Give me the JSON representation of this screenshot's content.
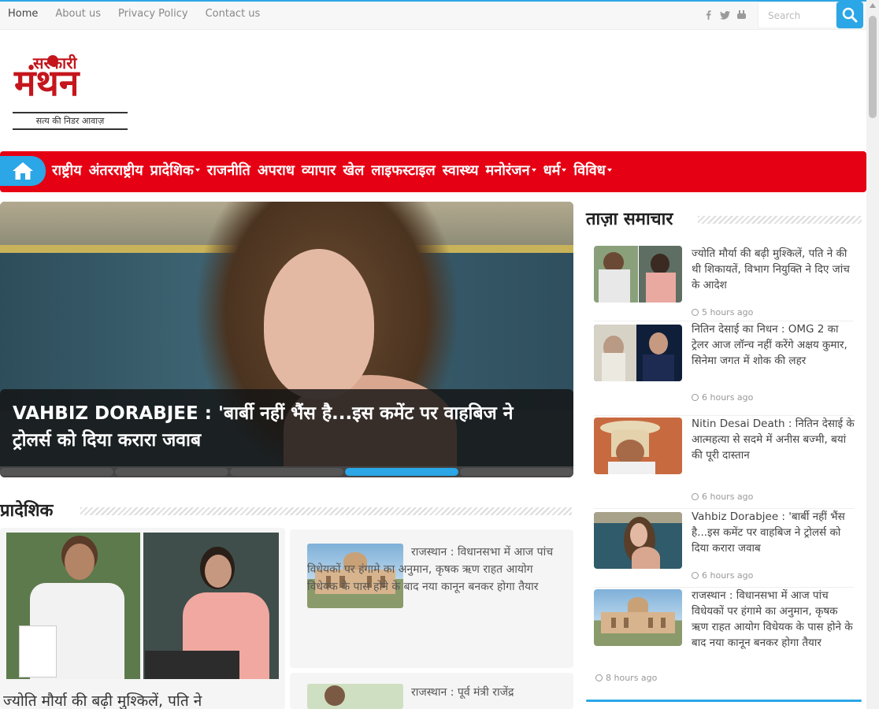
{
  "topbar": {
    "nav": [
      "Home",
      "About us",
      "Privacy Policy",
      "Contact us"
    ],
    "search_placeholder": "Search"
  },
  "logo": {
    "top": "सरकारी",
    "main": "मंथन",
    "tagline": "सत्य की निडर आवाज़"
  },
  "mainnav": {
    "items": [
      {
        "label": "राष्ट्रीय",
        "dropdown": false
      },
      {
        "label": "अंतरराष्ट्रीय",
        "dropdown": false
      },
      {
        "label": "प्रादेशिक",
        "dropdown": true
      },
      {
        "label": "राजनीति",
        "dropdown": false
      },
      {
        "label": "अपराध",
        "dropdown": false
      },
      {
        "label": "व्यापार",
        "dropdown": false
      },
      {
        "label": "खेल",
        "dropdown": false
      },
      {
        "label": "लाइफस्टाइल",
        "dropdown": false
      },
      {
        "label": "स्वास्थ्य",
        "dropdown": false
      },
      {
        "label": "मनोरंजन",
        "dropdown": true
      },
      {
        "label": "धर्म",
        "dropdown": true
      },
      {
        "label": "विविध",
        "dropdown": true
      }
    ]
  },
  "slider": {
    "caption": "VAHBIZ DORABJEE : 'बार्बी नहीं भैंस है...इस कमेंट पर वाहबिज ने ट्रोलर्स को दिया करारा जवाब",
    "active_slide": 4,
    "slide_count": 5
  },
  "latest": {
    "heading": "ताज़ा समाचार",
    "items": [
      {
        "title": "ज्योति मौर्या की बढ़ी मुश्किलें, पति ने की थी शिकायतें, विभाग नियुक्ति ने दिए जांच के आदेश",
        "time": "5 hours ago"
      },
      {
        "title": "नितिन देसाई का निधन : OMG 2 का ट्रेलर आज लॉन्च नहीं करेंगे अक्षय कुमार, सिनेमा जगत में शोक की लहर",
        "time": "6 hours ago"
      },
      {
        "title": "Nitin Desai Death : नितिन देसाई के आत्महत्या से सदमे में अनीस बज्मी, बयां की पूरी दास्तान",
        "time": "6 hours ago"
      },
      {
        "title": "Vahbiz Dorabjee : 'बार्बी नहीं भैंस है...इस कमेंट पर वाहबिज ने ट्रोलर्स को दिया करारा जवाब",
        "time": "6 hours ago"
      },
      {
        "title": "राजस्थान : विधानसभा में आज पांच विधेयकों पर हंगामे का अनुमान, कृषक ऋण राहत आयोग विधेयक के पास होने के बाद नया कानून बनकर होगा तैयार",
        "time": "8 hours ago"
      }
    ]
  },
  "regional": {
    "heading": "प्रादेशिक",
    "main_title": "ज्योति मौर्या की बढ़ी मुश्किलें, पति ने",
    "cards": [
      {
        "title": "राजस्थान : विधानसभा में आज पांच विधेयकों पर हंगामे का अनुमान, कृषक ऋण राहत आयोग विधेयक के पास होने के बाद नया कानून बनकर होगा तैयार"
      },
      {
        "title": "राजस्थान : पूर्व मंत्री राजेंद्र"
      }
    ]
  },
  "colors": {
    "accent": "#2ba6e6",
    "nav_red": "#e60013",
    "brand_red": "#c4161c"
  }
}
